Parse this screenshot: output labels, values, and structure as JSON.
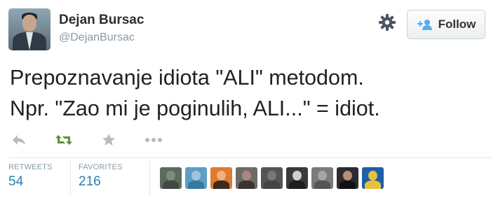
{
  "author": {
    "name": "Dejan Bursac",
    "handle": "@DejanBursac",
    "avatar_icon": "profile-photo"
  },
  "header": {
    "settings_icon": "gear-icon",
    "follow_label": "Follow",
    "follow_icon": "add-user-icon"
  },
  "tweet": {
    "lines": [
      "Prepoznavanje idiota \"ALI\" metodom.",
      "Npr. \"Zao mi je poginulih, ALI...\" = idiot."
    ]
  },
  "actions": [
    {
      "name": "reply",
      "icon": "reply-icon"
    },
    {
      "name": "retweet",
      "icon": "retweet-icon",
      "color": "#5c913b"
    },
    {
      "name": "favorite",
      "icon": "star-icon"
    },
    {
      "name": "more",
      "icon": "ellipsis-icon"
    }
  ],
  "stats": {
    "retweets_label": "RETWEETS",
    "retweets_value": "54",
    "favorites_label": "FAVORITES",
    "favorites_value": "216"
  },
  "colors": {
    "link": "#2a7fb3",
    "muted": "#8899a6",
    "icon_gray": "#b3bcc3",
    "retweet_green": "#5c913b"
  },
  "favoriters": [
    {
      "name": "favoriter-1",
      "bg": "#5b6a5e",
      "skin": "#7f8c7a",
      "cloth": "#3f4a43"
    },
    {
      "name": "favoriter-2",
      "bg": "#5d9ec4",
      "skin": "#9fc5dc",
      "cloth": "#3a78a0"
    },
    {
      "name": "favoriter-3",
      "bg": "#e07a2e",
      "skin": "#f2b07a",
      "cloth": "#3d2a20"
    },
    {
      "name": "favoriter-4",
      "bg": "#6f6a66",
      "skin": "#a8887a",
      "cloth": "#3b3532"
    },
    {
      "name": "favoriter-5",
      "bg": "#555555",
      "skin": "#777777",
      "cloth": "#444444"
    },
    {
      "name": "favoriter-6",
      "bg": "#3a3a3a",
      "skin": "#cfcfcf",
      "cloth": "#1e1e1e"
    },
    {
      "name": "favoriter-7",
      "bg": "#7a7a7a",
      "skin": "#a5a5a5",
      "cloth": "#555555"
    },
    {
      "name": "favoriter-8",
      "bg": "#2c2c30",
      "skin": "#b98e73",
      "cloth": "#111114"
    },
    {
      "name": "favoriter-9",
      "bg": "#1f5fa8",
      "skin": "#e5c23a",
      "cloth": "#e5c23a"
    }
  ]
}
